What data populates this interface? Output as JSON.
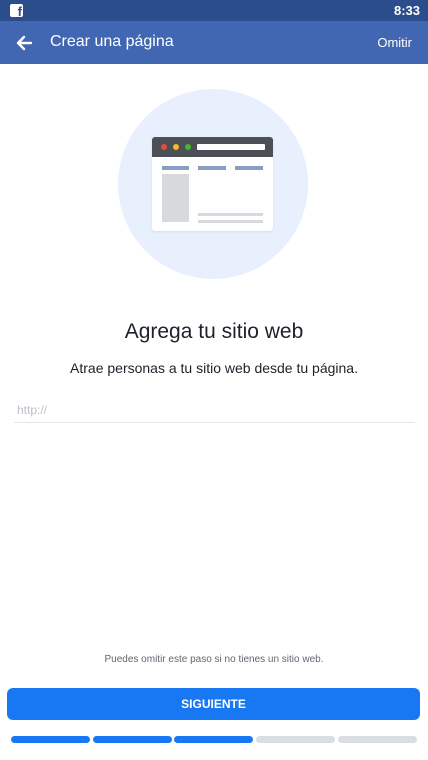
{
  "status_bar": {
    "time": "8:33",
    "notification_icon": "facebook-icon"
  },
  "app_bar": {
    "back_icon": "arrow-left-icon",
    "title": "Crear una página",
    "skip_label": "Omitir"
  },
  "illustration": {
    "icon": "browser-window-illustration",
    "dot_colors": [
      "#e84b3c",
      "#f7b928",
      "#42b72a"
    ]
  },
  "content": {
    "heading": "Agrega tu sitio web",
    "subtitle": "Atrae personas a tu sitio web desde tu página.",
    "url_field": {
      "value": "",
      "placeholder": "http://"
    },
    "hint": "Puedes omitir este paso si no tienes un sitio web."
  },
  "footer": {
    "next_label": "SIGUIENTE",
    "progress": {
      "total_steps": 5,
      "completed_steps": 3,
      "active_color": "#1877f2",
      "inactive_color": "#dadde1"
    }
  },
  "colors": {
    "app_bar": "#4267b2",
    "status_bar": "#2c4d8c",
    "accent": "#1877f2"
  }
}
